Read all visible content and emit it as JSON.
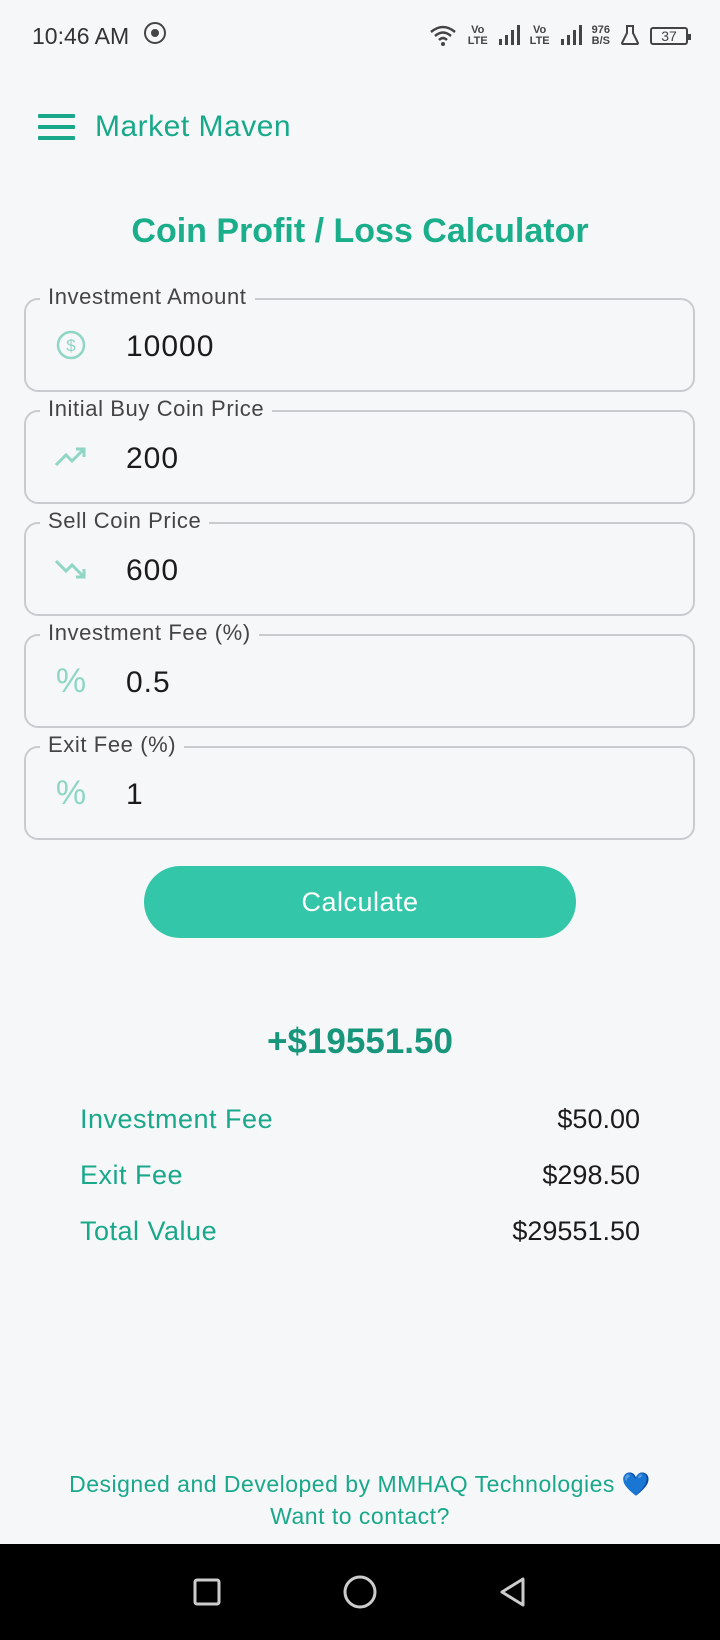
{
  "status_bar": {
    "time": "10:46 AM",
    "volte1_top": "Vo",
    "volte1_bottom": "LTE",
    "volte2_top": "Vo",
    "volte2_bottom": "LTE",
    "speed_top": "976",
    "speed_bottom": "B/S",
    "battery": "37"
  },
  "app_bar": {
    "title": "Market Maven"
  },
  "page": {
    "title": "Coin Profit / Loss Calculator"
  },
  "fields": {
    "investment_amount": {
      "label": "Investment Amount",
      "value": "10000",
      "icon": "dollar-circle-icon"
    },
    "initial_buy_price": {
      "label": "Initial Buy Coin Price",
      "value": "200",
      "icon": "trending-up-icon"
    },
    "sell_price": {
      "label": "Sell Coin Price",
      "value": "600",
      "icon": "trending-down-icon"
    },
    "investment_fee": {
      "label": "Investment Fee (%)",
      "value": "0.5",
      "icon": "percent-icon"
    },
    "exit_fee": {
      "label": "Exit Fee (%)",
      "value": "1",
      "icon": "percent-icon"
    }
  },
  "calculate_label": "Calculate",
  "results": {
    "profit": "+$19551.50",
    "rows": [
      {
        "label": "Investment Fee",
        "value": "$50.00"
      },
      {
        "label": "Exit Fee",
        "value": "$298.50"
      },
      {
        "label": "Total Value",
        "value": "$29551.50"
      }
    ]
  },
  "footer": {
    "credit": "Designed and Developed by MMHAQ Technologies 💙",
    "contact": "Want to contact?"
  },
  "colors": {
    "accent": "#1aa88a",
    "button": "#34c6a8",
    "icon": "#8fd6c4",
    "profit": "#17967b"
  }
}
